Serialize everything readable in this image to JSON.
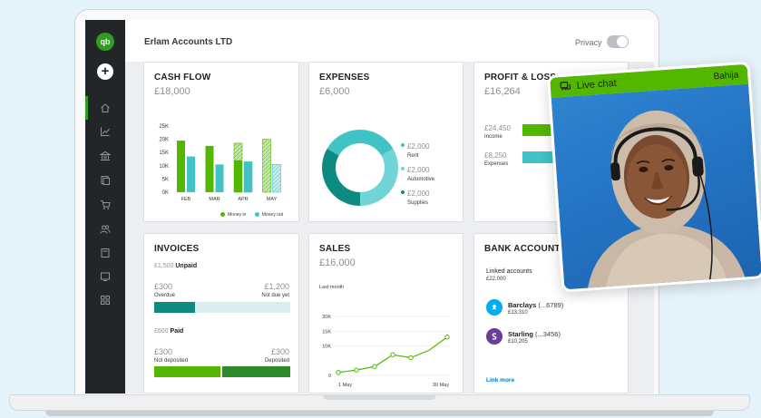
{
  "company_name": "Erlam Accounts LTD",
  "privacy_label": "Privacy",
  "nav": {
    "logo_text": "qb",
    "new_symbol": "+",
    "items": [
      "home-icon",
      "chart-icon",
      "bank-icon",
      "receipt-icon",
      "cart-icon",
      "people-icon",
      "calculator-icon",
      "tablet-icon",
      "apps-icon"
    ]
  },
  "cash_flow": {
    "title": "CASH FLOW",
    "amount": "£18,000",
    "y_ticks": [
      "25K",
      "20K",
      "15K",
      "10K",
      "5K",
      "0K"
    ],
    "legend_in": "Money in",
    "legend_out": "Money out"
  },
  "expenses": {
    "title": "EXPENSES",
    "amount": "£6,000",
    "items": [
      {
        "value": "£2,000",
        "label": "Rent",
        "color": "#41c3c6"
      },
      {
        "value": "£2,000",
        "label": "Automotive",
        "color": "#6fd5d7"
      },
      {
        "value": "£2,000",
        "label": "Supplies",
        "color": "#0e8b80"
      }
    ]
  },
  "profit_loss": {
    "title": "PROFIT & LOSS",
    "amount": "£16,264",
    "income_value": "£24,450",
    "income_label": "Income",
    "expenses_value": "£8,250",
    "expenses_label": "Expenses"
  },
  "invoices": {
    "title": "INVOICES",
    "unpaid_amount": "£1,500",
    "unpaid_label": "Unpaid",
    "overdue_value": "£300",
    "overdue_label": "Overdue",
    "not_due_value": "£1,200",
    "not_due_label": "Not due yet",
    "paid_amount": "£600",
    "paid_label": "Paid",
    "not_deposited_value": "£300",
    "not_deposited_label": "Not deposited",
    "deposited_value": "£300",
    "deposited_label": "Deposited",
    "unpaid_overdue_fraction": 0.2,
    "paid_not_deposited_fraction": 0.5
  },
  "sales": {
    "title": "SALES",
    "amount": "£16,000",
    "period_label": "Last month"
  },
  "bank_accounts": {
    "title": "BANK ACCOUNTS",
    "linked_label": "Linked accounts",
    "linked_total": "£22,000",
    "accounts": [
      {
        "name": "Barclays",
        "number": "(...6789)",
        "balance": "£13,310"
      },
      {
        "name": "Starling",
        "number": "(...3456)",
        "balance": "£10,205"
      }
    ],
    "link_more": "Link more"
  },
  "live_chat": {
    "label": "Live chat",
    "agent_name": "Bahija"
  },
  "chart_data": [
    {
      "type": "bar",
      "title": "CASH FLOW",
      "categories": [
        "FEB",
        "MAR",
        "APR",
        "MAY"
      ],
      "ylim": [
        0,
        25000
      ],
      "y_ticks": [
        "25K",
        "20K",
        "15K",
        "10K",
        "5K",
        "0K"
      ],
      "series": [
        {
          "name": "Money in",
          "color": "#53b700",
          "values": [
            19500,
            17500,
            18500,
            20000
          ]
        },
        {
          "name": "Money out",
          "color": "#41c3c6",
          "values": [
            13500,
            10500,
            11500,
            10500
          ]
        }
      ],
      "legend": "bottom-right"
    },
    {
      "type": "pie",
      "title": "EXPENSES",
      "slices": [
        {
          "name": "Rent",
          "value": 2000,
          "color": "#41c3c6"
        },
        {
          "name": "Automotive",
          "value": 2000,
          "color": "#6fd5d7"
        },
        {
          "name": "Supplies",
          "value": 2000,
          "color": "#0e8b80"
        }
      ]
    },
    {
      "type": "bar",
      "title": "PROFIT & LOSS",
      "categories": [
        "Income",
        "Expenses"
      ],
      "values": [
        24450,
        8250
      ]
    },
    {
      "type": "line",
      "title": "SALES",
      "y_ticks": [
        "20K",
        "15K",
        "10K",
        "0"
      ],
      "ylim": [
        0,
        20000
      ],
      "x_labels": [
        "1 May",
        "30 May"
      ],
      "values": [
        1000,
        1800,
        3000,
        7000,
        6000,
        8500,
        13000
      ]
    }
  ]
}
